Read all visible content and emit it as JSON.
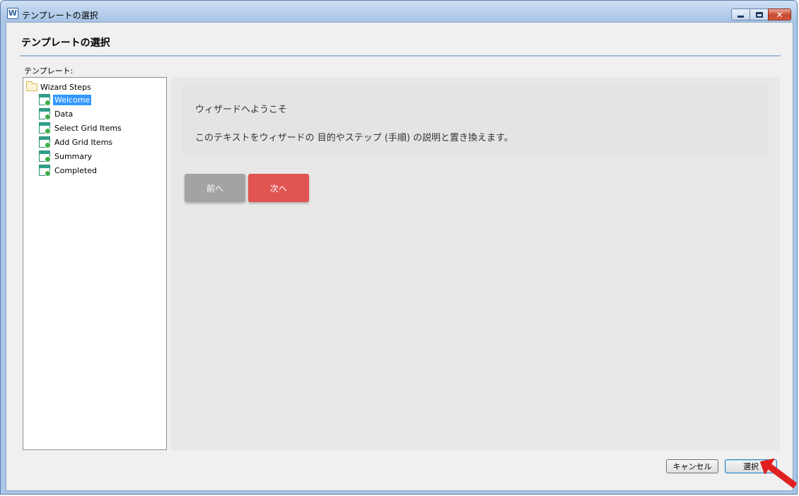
{
  "window": {
    "title": "テンプレートの選択",
    "icon": "app-icon",
    "icon_glyph": "W",
    "controls": {
      "minimize": "minimize-icon",
      "maximize": "maximize-icon",
      "close": "close-icon",
      "close_glyph": "✕"
    }
  },
  "header": {
    "title": "テンプレートの選択"
  },
  "tree": {
    "label": "テンプレート:",
    "root": {
      "label": "Wizard Steps",
      "icon": "folder-icon"
    },
    "items": [
      {
        "label": "Welcome",
        "icon": "wizard-page-icon",
        "selected": true
      },
      {
        "label": "Data",
        "icon": "wizard-page-icon",
        "selected": false
      },
      {
        "label": "Select Grid Items",
        "icon": "wizard-page-icon",
        "selected": false
      },
      {
        "label": "Add Grid Items",
        "icon": "wizard-page-icon",
        "selected": false
      },
      {
        "label": "Summary",
        "icon": "wizard-page-icon",
        "selected": false
      },
      {
        "label": "Completed",
        "icon": "wizard-page-icon",
        "selected": false
      }
    ]
  },
  "preview": {
    "heading": "ウィザードへようこそ",
    "text": "このテキストをウィザードの 目的やステップ (手順) の説明と置き換えます。",
    "prev_label": "前へ",
    "next_label": "次へ"
  },
  "footer": {
    "cancel_label": "キャンセル",
    "select_label": "選択"
  },
  "colors": {
    "selection": "#3399ff",
    "next_button": "#e05452",
    "prev_button": "#a3a3a3",
    "annotation_arrow": "#e02020"
  }
}
